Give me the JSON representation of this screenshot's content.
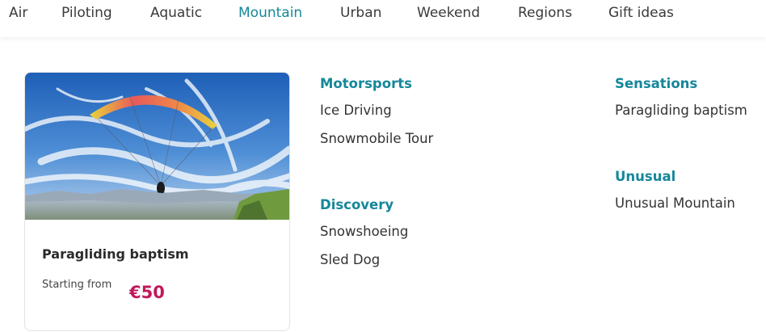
{
  "nav": {
    "items": [
      {
        "label": "Air"
      },
      {
        "label": "Piloting"
      },
      {
        "label": "Aquatic"
      },
      {
        "label": "Mountain"
      },
      {
        "label": "Urban"
      },
      {
        "label": "Weekend"
      },
      {
        "label": "Regions"
      },
      {
        "label": "Gift ideas"
      }
    ],
    "active_index": 3,
    "active_color": "#15879a"
  },
  "featured": {
    "title": "Paragliding baptism",
    "price_prefix": "Starting from",
    "price": "€50",
    "price_color": "#c2185b"
  },
  "categories": [
    {
      "title": "Motorsports",
      "links": [
        "Ice Driving",
        "Snowmobile Tour"
      ]
    },
    {
      "title": "Discovery",
      "links": [
        "Snowshoeing",
        "Sled Dog"
      ]
    },
    {
      "title": "Sensations",
      "links": [
        "Paragliding baptism"
      ]
    },
    {
      "title": "Unusual",
      "links": [
        "Unusual Mountain"
      ]
    }
  ]
}
